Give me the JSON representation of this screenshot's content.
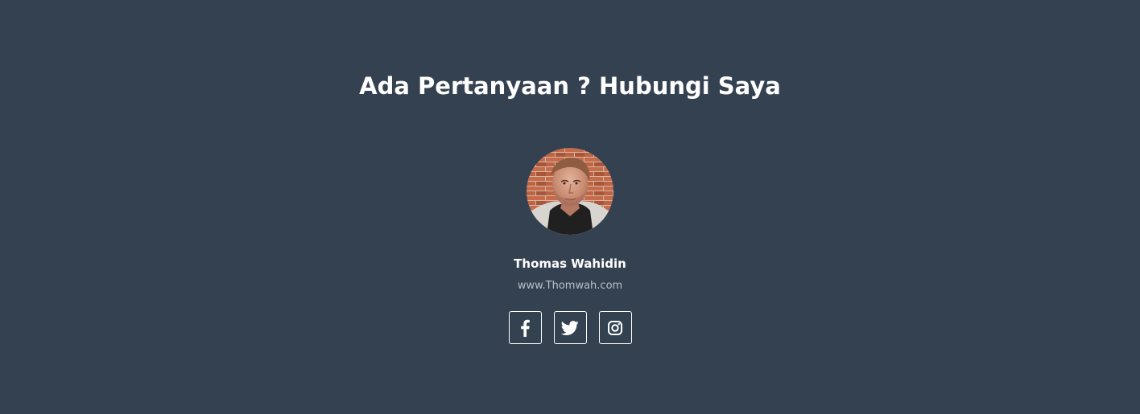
{
  "contact": {
    "title": "Ada Pertanyaan ? Hubungi Saya",
    "name": "Thomas Wahidin",
    "website": "www.Thomwah.com",
    "avatar_icon": "profile-photo",
    "social_links": [
      {
        "icon": "facebook-icon",
        "label": "Facebook"
      },
      {
        "icon": "twitter-icon",
        "label": "Twitter"
      },
      {
        "icon": "instagram-icon",
        "label": "Instagram"
      }
    ]
  },
  "colors": {
    "background": "#344150",
    "text": "#ffffff",
    "muted_text": "#b8c0c9",
    "button_border": "#ffffff"
  }
}
